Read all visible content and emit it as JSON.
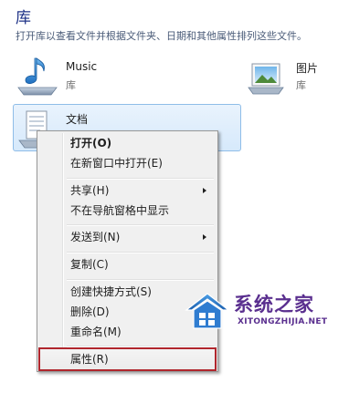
{
  "header": {
    "title": "库",
    "description": "打开库以查看文件并根据文件夹、日期和其他属性排列这些文件。"
  },
  "libraries": [
    {
      "name": "Music",
      "type": "库",
      "icon": "music-library-icon"
    },
    {
      "name": "图片",
      "type": "库",
      "icon": "pictures-library-icon"
    },
    {
      "name": "文档",
      "type": "",
      "icon": "documents-library-icon"
    }
  ],
  "context_menu": {
    "items": [
      {
        "label": "打开(O)",
        "bold": true
      },
      {
        "label": "在新窗口中打开(E)"
      },
      {
        "label": "共享(H)",
        "submenu": true
      },
      {
        "label": "不在导航窗格中显示"
      },
      {
        "label": "发送到(N)",
        "submenu": true
      },
      {
        "label": "复制(C)"
      },
      {
        "label": "创建快捷方式(S)"
      },
      {
        "label": "删除(D)"
      },
      {
        "label": "重命名(M)"
      },
      {
        "label": "属性(R)",
        "highlighted": true
      }
    ]
  },
  "watermark": {
    "title": "系统之家",
    "url": "XITONGZHIJIA.NET"
  },
  "colors": {
    "title": "#1e3287",
    "selection": "#d6e9fb",
    "highlight_outline": "#b0262d",
    "watermark": "#5a2f8f"
  }
}
